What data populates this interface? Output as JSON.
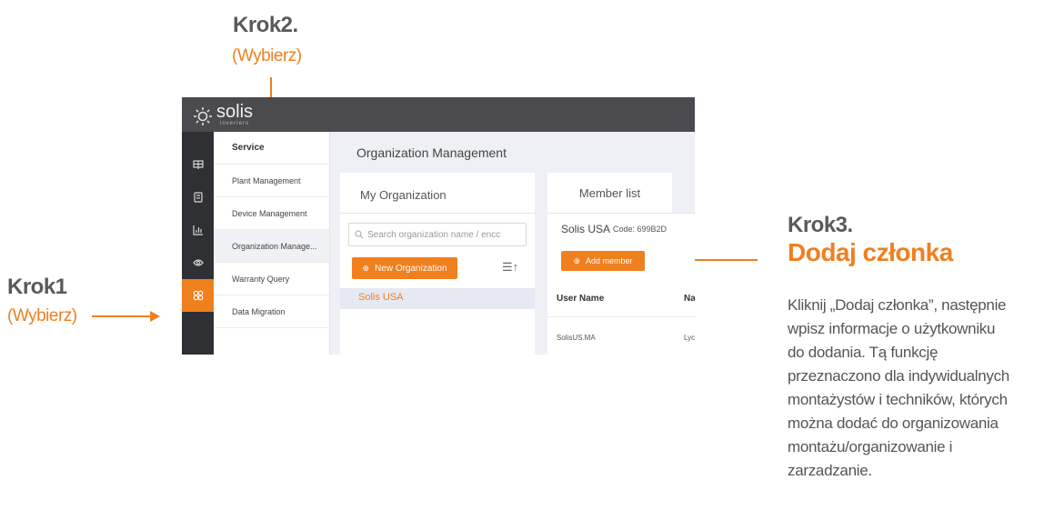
{
  "annotations": {
    "step1": {
      "title": "Krok1",
      "subtitle": "(Wybierz)"
    },
    "step2": {
      "title": "Krok2.",
      "subtitle": "(Wybierz)"
    },
    "step3": {
      "title": "Krok3.",
      "subtitle": "Dodaj członka"
    },
    "description_lines": [
      "Kliknij „Dodaj członka”, następnie",
      "wpisz informacje o użytkowniku",
      "do dodania. Tą funkcję",
      "przeznaczono dla indywidualnych",
      "montażystów i techników, których",
      "można dodać do organizowania",
      "montażu/organizowanie i",
      "zarzadzanie."
    ],
    "accent_color": "#f07f1e"
  },
  "app": {
    "logo": {
      "text": "solis",
      "subtext": "inverters"
    },
    "sidebar_icons": [
      "map-icon",
      "device-icon",
      "chart-icon",
      "eye-icon",
      "service-icon"
    ],
    "active_icon_index": 4,
    "menu": {
      "header": "Service",
      "items": [
        {
          "label": "Plant Management"
        },
        {
          "label": "Device Management"
        },
        {
          "label": "Organization Manage..."
        },
        {
          "label": "Warranty Query"
        },
        {
          "label": "Data Migration"
        }
      ],
      "active_index": 2
    },
    "page_title": "Organization Management",
    "org_panel": {
      "title": "My Organization",
      "search_placeholder": "Search organization name / encc",
      "new_button": "New Organization",
      "organizations": [
        "Solis USA"
      ]
    },
    "member_panel": {
      "tab": "Member list",
      "org_name": "Solis USA",
      "code": "Code: 699B2D",
      "add_button": "Add member",
      "columns": [
        "User Name",
        "Na"
      ],
      "rows": [
        {
          "user": "SolisUS.MA",
          "name": "Lyc"
        }
      ]
    }
  }
}
